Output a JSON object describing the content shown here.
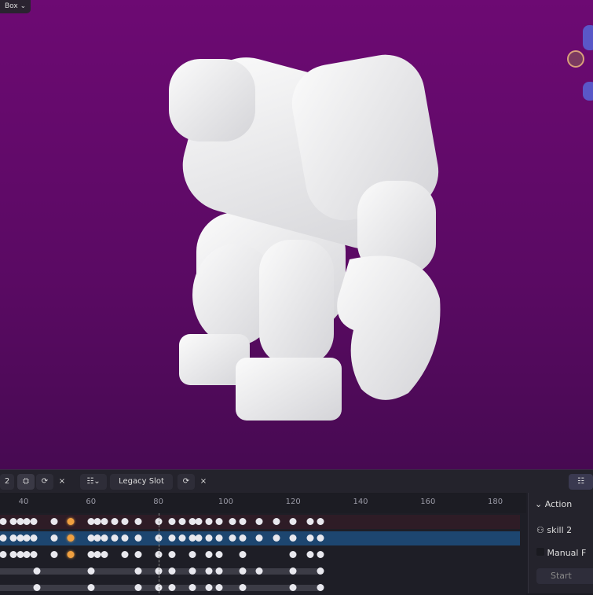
{
  "viewport": {
    "mode_label": "Box",
    "background_top": "#6d0a73",
    "background_bottom": "#470a52"
  },
  "dopesheet": {
    "header": {
      "slot_number": "2",
      "slot_label": "Legacy Slot"
    },
    "ruler_ticks": [
      "40",
      "60",
      "80",
      "100",
      "120",
      "140",
      "160",
      "180"
    ],
    "current_frame": 80,
    "rows": [
      {
        "keys": [
          34,
          37,
          39,
          41,
          43,
          49,
          54,
          60,
          62,
          64,
          67,
          70,
          74,
          80,
          84,
          87,
          90,
          92,
          95,
          98,
          102,
          105,
          110,
          115,
          120,
          125,
          128
        ],
        "selected": [
          54
        ]
      },
      {
        "keys": [
          34,
          37,
          39,
          41,
          43,
          49,
          54,
          60,
          62,
          64,
          67,
          70,
          74,
          80,
          84,
          87,
          90,
          92,
          95,
          98,
          102,
          105,
          110,
          115,
          120,
          125,
          128
        ],
        "selected": [
          54
        ]
      },
      {
        "keys": [
          34,
          37,
          39,
          41,
          43,
          49,
          54,
          60,
          62,
          64,
          70,
          74,
          80,
          84,
          90,
          95,
          98,
          105,
          120,
          125,
          128
        ],
        "selected": [
          54
        ]
      },
      {
        "keys": [
          44,
          60,
          74,
          80,
          84,
          90,
          95,
          98,
          105,
          110,
          120,
          128
        ],
        "selected": []
      },
      {
        "keys": [
          44,
          60,
          74,
          80,
          84,
          90,
          95,
          98,
          105,
          120,
          128
        ],
        "selected": []
      }
    ],
    "row_colors": [
      "#2e1c26",
      "#1d4670",
      "#1e1e26",
      "#1e1e26",
      "#1e1e26"
    ]
  },
  "sidebar": {
    "panel_title": "Action",
    "action_name": "skill 2",
    "manual_label": "Manual F",
    "start_label": "Start"
  }
}
